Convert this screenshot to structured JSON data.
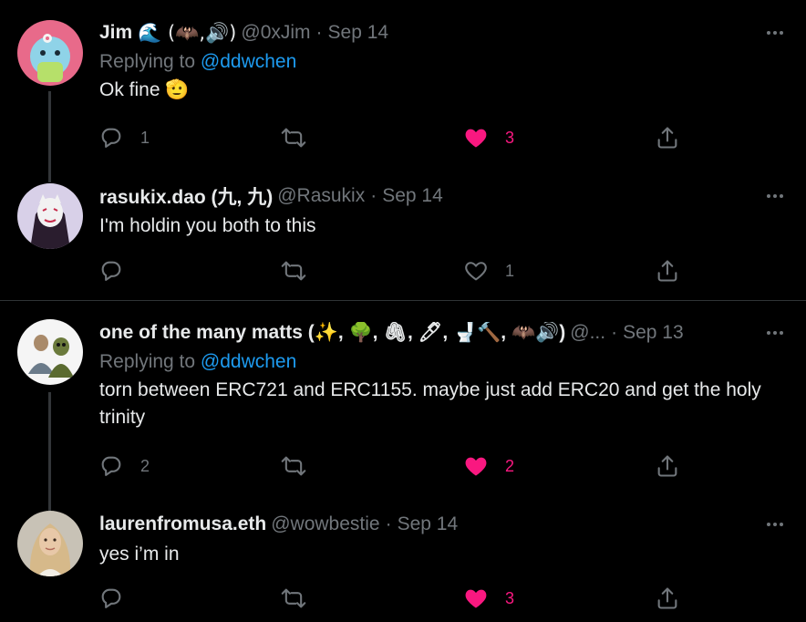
{
  "tweets": [
    {
      "name": "Jim",
      "name_emoji": "🌊 (🦇,🔊)",
      "handle": "@0xJim",
      "date": "Sep 14",
      "reply_label": "Replying to",
      "reply_to": "@ddwchen",
      "text": "Ok fine 🫡",
      "reply_count": "1",
      "retweet_count": "",
      "like_count": "3",
      "liked": true
    },
    {
      "name": "rasukix.dao (九, 九)",
      "handle": "@Rasukix",
      "date": "Sep 14",
      "text": "I'm holdin you both to this",
      "reply_count": "",
      "retweet_count": "",
      "like_count": "1",
      "liked": false
    },
    {
      "name": "one of the many matts (✨, 🌳, 🖇, 🖊, 🚽🔨, 🦇🔊)",
      "handle": "@...",
      "date": "Sep 13",
      "reply_label": "Replying to",
      "reply_to": "@ddwchen",
      "text": "torn between ERC721 and ERC1155. maybe just add ERC20 and get the holy trinity",
      "reply_count": "2",
      "retweet_count": "",
      "like_count": "2",
      "liked": true
    },
    {
      "name": "laurenfromusa.eth",
      "handle": "@wowbestie",
      "date": "Sep 14",
      "text": "yes i’m in",
      "reply_count": "",
      "retweet_count": "",
      "like_count": "3",
      "liked": true
    }
  ],
  "separator": "·",
  "icons": {
    "reply": "reply-icon",
    "retweet": "retweet-icon",
    "like": "heart-icon",
    "share": "share-icon",
    "more": "more-icon"
  },
  "colors": {
    "background": "#000000",
    "text": "#e7e9ea",
    "muted": "#71767b",
    "link": "#1d9bf0",
    "like": "#f91880"
  }
}
